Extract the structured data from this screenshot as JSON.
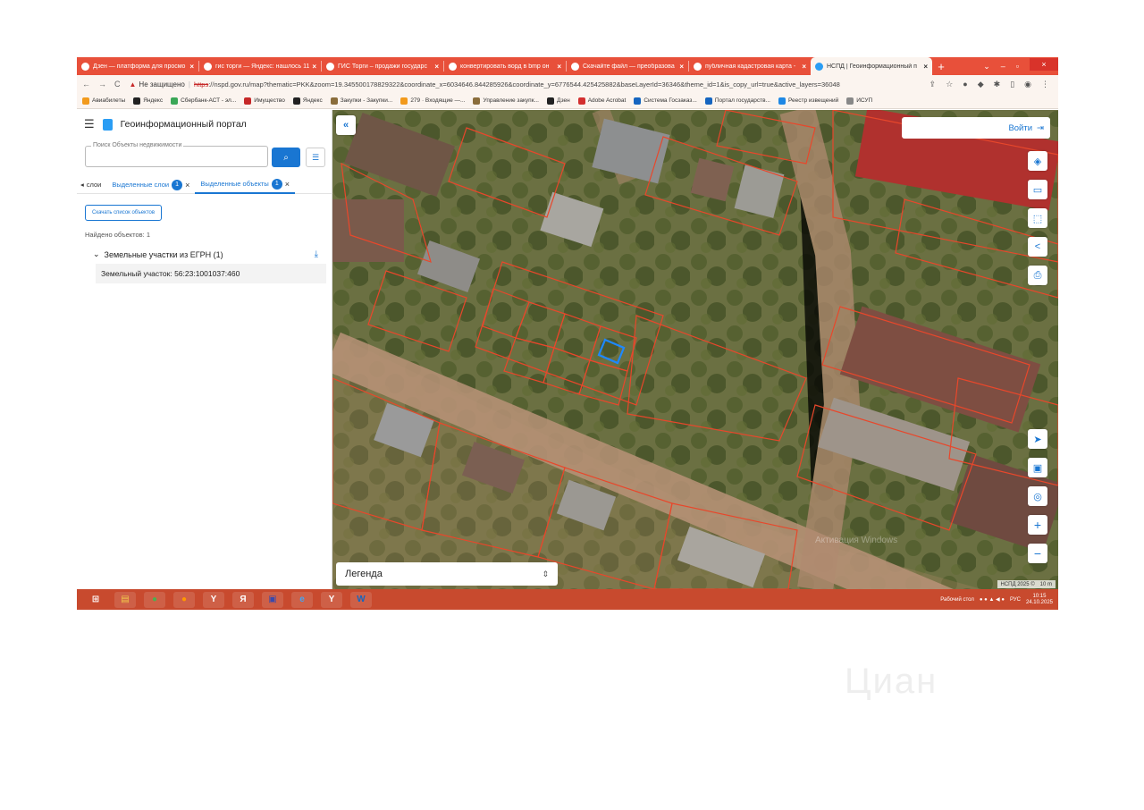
{
  "browser": {
    "tabs": [
      {
        "title": "Дзен — платформа для просмо",
        "active": false
      },
      {
        "title": "гис торги — Яндекс: нашлось 11",
        "active": false
      },
      {
        "title": "ГИС Торги – продажи государс",
        "active": false
      },
      {
        "title": "конвертировать ворд в bmp он",
        "active": false
      },
      {
        "title": "Скачайте файл — преобразова",
        "active": false
      },
      {
        "title": "публичная кадастровая карта -",
        "active": false
      },
      {
        "title": "НСПД | Геоинформационный п",
        "active": true
      }
    ],
    "new_tab": "+",
    "window_controls": {
      "dropdown": "⌄",
      "minimize": "–",
      "maximize": "▫",
      "close": "×"
    },
    "nav": {
      "back": "←",
      "forward": "→",
      "reload": "C"
    },
    "security_label": "Не защищено",
    "url_scheme": "https",
    "url_rest": "://nspd.gov.ru/map?thematic=PKK&zoom=19.345500178829322&coordinate_x=6034646.844285926&coordinate_y=6776544.425425882&baseLayerId=36346&theme_id=1&is_copy_url=true&active_layers=36048",
    "bookmarks": [
      {
        "label": "Авиабилеты",
        "color": "#f29a1c"
      },
      {
        "label": "Яндекс",
        "color": "#222222"
      },
      {
        "label": "Сбербанк-АСТ - эл...",
        "color": "#3aa757"
      },
      {
        "label": "Имущество",
        "color": "#c62828"
      },
      {
        "label": "Яндекс",
        "color": "#222222"
      },
      {
        "label": "Закупки - Закупки...",
        "color": "#8a6d3b"
      },
      {
        "label": "279 · Входящие —...",
        "color": "#f29a1c"
      },
      {
        "label": "Управление закупк...",
        "color": "#8a6d3b"
      },
      {
        "label": "Дзен",
        "color": "#222222"
      },
      {
        "label": "Adobe Acrobat",
        "color": "#d32f2f"
      },
      {
        "label": "Система Госзаказ...",
        "color": "#1565c0"
      },
      {
        "label": "Портал государств...",
        "color": "#1565c0"
      },
      {
        "label": "Реестр извещений",
        "color": "#1e88e5"
      },
      {
        "label": "ИСУП",
        "color": "#888888"
      }
    ]
  },
  "sidebar": {
    "title": "Геоинформационный портал",
    "search": {
      "label": "Поиск Объекты недвижимости",
      "value": ""
    },
    "tabs": [
      {
        "label": "слои",
        "badge": ""
      },
      {
        "label": "Выделенные слои",
        "badge": "1"
      },
      {
        "label": "Выделенные объекты",
        "badge": "1"
      }
    ],
    "download_button": "Скачать список объектов",
    "found_text": "Найдено объектов: 1",
    "group_title": "Земельные участки из ЕГРН (1)",
    "parcel": "Земельный участок: 56:23:1001037:460"
  },
  "map": {
    "login_label": "Войти",
    "legend_label": "Легенда",
    "copyright": "НСПД 2025 ©",
    "scale": "10 m",
    "activation_text": "Активация Windows",
    "control_icons": [
      "layers-icon",
      "ruler-icon",
      "select-area-icon",
      "share-icon",
      "print-icon",
      "locate-icon",
      "minimap-icon",
      "poi-icon"
    ],
    "zoom_in": "+",
    "zoom_out": "−",
    "colors": {
      "parcel_border": "#e8472b",
      "selected_parcel": "#1e88ff",
      "accent": "#1976d2"
    }
  },
  "taskbar": {
    "apps": [
      {
        "name": "start-icon",
        "glyph": "⊞",
        "color": "#ffffff"
      },
      {
        "name": "explorer-icon",
        "glyph": "▤",
        "color": "#f2c94c"
      },
      {
        "name": "chrome-icon",
        "glyph": "●",
        "color": "#4caf50"
      },
      {
        "name": "firefox-icon",
        "glyph": "●",
        "color": "#ff9800"
      },
      {
        "name": "yandex-browser-icon",
        "glyph": "Y",
        "color": "#ffffff"
      },
      {
        "name": "yandex-icon",
        "glyph": "Я",
        "color": "#ffffff"
      },
      {
        "name": "save-icon",
        "glyph": "▣",
        "color": "#3949ab"
      },
      {
        "name": "ie-icon",
        "glyph": "e",
        "color": "#42a5f5"
      },
      {
        "name": "yandex-icon-2",
        "glyph": "Y",
        "color": "#ffffff"
      },
      {
        "name": "word-icon",
        "glyph": "W",
        "color": "#1565c0"
      }
    ],
    "desktop_label": "Рабочий стол",
    "lang": "РУС",
    "time": "10:15",
    "date": "24.10.2025"
  },
  "watermark": "Циан"
}
